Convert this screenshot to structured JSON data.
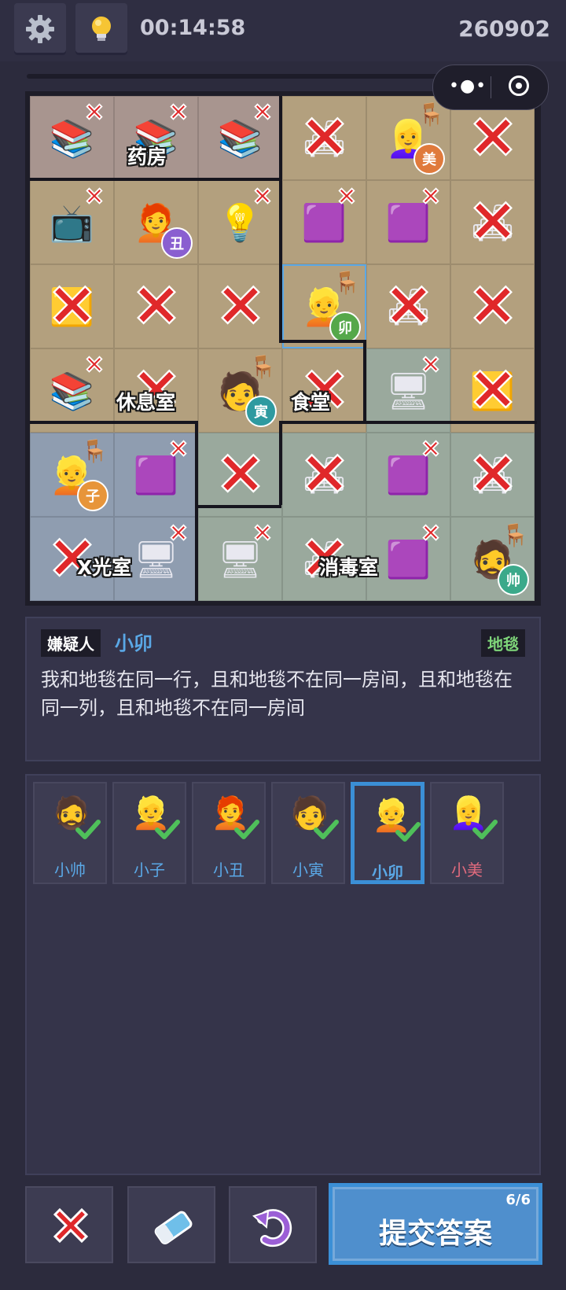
{
  "header": {
    "timer": "00:14:58",
    "score": "260902",
    "settings_icon": "gear-icon",
    "hint_icon": "lightbulb-icon"
  },
  "rooms": [
    {
      "id": "pharmacy",
      "label": "药房",
      "color": "#a8958f"
    },
    {
      "id": "lounge",
      "label": "休息室",
      "color": "#b3a07e"
    },
    {
      "id": "canteen",
      "label": "食堂",
      "color": "#b3a07e"
    },
    {
      "id": "xray",
      "label": "X光室",
      "color": "#8f9db0"
    },
    {
      "id": "disinfect",
      "label": "消毒室",
      "color": "#9aa99d"
    },
    {
      "id": "east",
      "label": "",
      "color": "#b3a07e"
    }
  ],
  "board": {
    "rows": [
      [
        {
          "room": "pharmacy",
          "item": "bookshelf",
          "x": "mini"
        },
        {
          "room": "pharmacy",
          "item": "bookshelf",
          "x": "mini"
        },
        {
          "room": "pharmacy",
          "item": "bookshelf",
          "x": "mini"
        },
        {
          "room": "east",
          "item": "chair",
          "x": "big"
        },
        {
          "room": "east",
          "item": "person",
          "person": "mei",
          "badge": "美",
          "x": ""
        },
        {
          "room": "east",
          "item": "",
          "x": "big"
        }
      ],
      [
        {
          "room": "lounge",
          "item": "tv",
          "x": "mini"
        },
        {
          "room": "lounge",
          "item": "person",
          "person": "chou",
          "badge": "丑",
          "x": ""
        },
        {
          "room": "lounge",
          "item": "lamp",
          "x": "mini"
        },
        {
          "room": "east",
          "item": "table",
          "x": "mini"
        },
        {
          "room": "east",
          "item": "table",
          "x": "mini"
        },
        {
          "room": "east",
          "item": "chair",
          "x": "big"
        }
      ],
      [
        {
          "room": "lounge",
          "item": "carpet",
          "x": "big"
        },
        {
          "room": "lounge",
          "item": "",
          "x": "big"
        },
        {
          "room": "lounge",
          "item": "",
          "x": "big"
        },
        {
          "room": "canteen",
          "item": "person",
          "person": "mao",
          "badge": "卯",
          "x": "",
          "selected": true
        },
        {
          "room": "east",
          "item": "chair",
          "x": "big"
        },
        {
          "room": "east",
          "item": "",
          "x": "big"
        }
      ],
      [
        {
          "room": "lounge",
          "item": "bookshelf",
          "x": "mini"
        },
        {
          "room": "lounge",
          "item": "",
          "x": "big"
        },
        {
          "room": "lounge",
          "item": "person",
          "person": "yin",
          "badge": "寅",
          "x": ""
        },
        {
          "room": "canteen",
          "item": "",
          "x": "big"
        },
        {
          "room": "disinfect",
          "item": "computer",
          "x": "mini"
        },
        {
          "room": "east",
          "item": "carpet",
          "x": "big"
        }
      ],
      [
        {
          "room": "xray",
          "item": "person",
          "person": "zi",
          "badge": "子",
          "x": ""
        },
        {
          "room": "xray",
          "item": "table",
          "x": "mini"
        },
        {
          "room": "disinfect",
          "item": "",
          "x": "big"
        },
        {
          "room": "disinfect",
          "item": "chair",
          "x": "big"
        },
        {
          "room": "disinfect",
          "item": "table",
          "x": "mini"
        },
        {
          "room": "disinfect",
          "item": "chair",
          "x": "big"
        }
      ],
      [
        {
          "room": "xray",
          "item": "",
          "x": "big"
        },
        {
          "room": "xray",
          "item": "computer",
          "x": "mini"
        },
        {
          "room": "disinfect",
          "item": "computer",
          "x": "mini"
        },
        {
          "room": "disinfect",
          "item": "carpet-chair",
          "x": "big"
        },
        {
          "room": "disinfect",
          "item": "table",
          "x": "mini"
        },
        {
          "room": "disinfect",
          "item": "person",
          "person": "shuai",
          "badge": "帅",
          "x": ""
        }
      ]
    ]
  },
  "hint": {
    "tag": "嫌疑人",
    "suspect": "小卯",
    "item": "地毯",
    "text": "我和地毯在同一行，且和地毯不在同一房间，且和地毯在同一列，且和地毯不在同一房间"
  },
  "suspects": [
    {
      "id": "shuai",
      "name": "小帅",
      "done": true
    },
    {
      "id": "zi",
      "name": "小子",
      "done": true
    },
    {
      "id": "chou",
      "name": "小丑",
      "done": true
    },
    {
      "id": "yin",
      "name": "小寅",
      "done": true
    },
    {
      "id": "mao",
      "name": "小卯",
      "done": true,
      "active": true
    },
    {
      "id": "mei",
      "name": "小美",
      "done": true
    }
  ],
  "actions": {
    "cross_icon": "cross-icon",
    "eraser_icon": "eraser-icon",
    "undo_icon": "undo-icon",
    "submit_label": "提交答案",
    "submit_count": "6/6"
  },
  "colors": {
    "accent": "#3b8fd6",
    "cross": "#e0282a",
    "check": "#4fc05a"
  }
}
